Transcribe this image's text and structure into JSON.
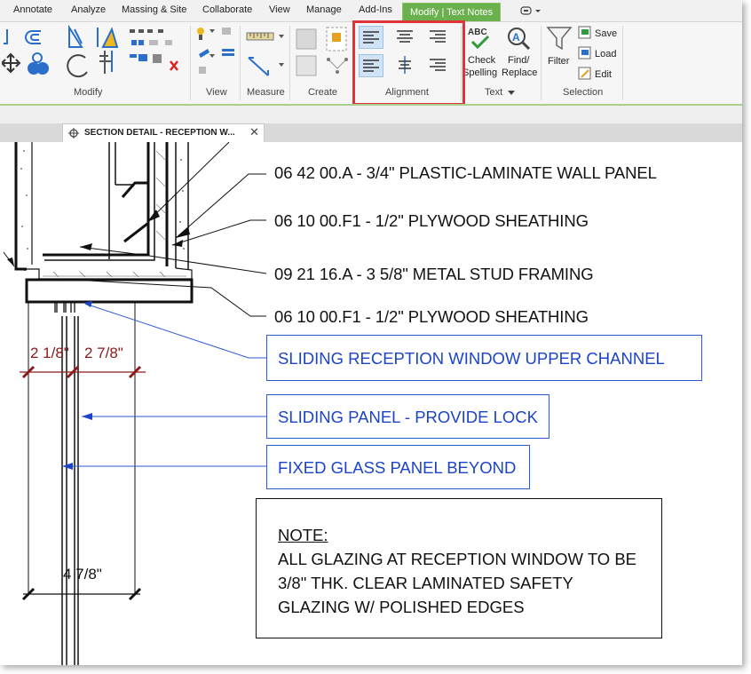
{
  "ribbon": {
    "tabs": [
      "Annotate",
      "Analyze",
      "Massing & Site",
      "Collaborate",
      "View",
      "Manage",
      "Add-Ins",
      "Modify | Text Notes"
    ],
    "active_tab": "Modify | Text Notes",
    "accent_color": "#6ab04c",
    "panels": {
      "modify": "Modify",
      "view": "View",
      "measure": "Measure",
      "create": "Create",
      "alignment": "Alignment",
      "text": "Text",
      "selection": "Selection"
    },
    "text_tools": {
      "check": "Check",
      "spelling": "Spelling",
      "find": "Find/",
      "replace": "Replace"
    },
    "selection_tools": {
      "filter": "Filter",
      "save": "Save",
      "load": "Load",
      "edit": "Edit"
    },
    "highlight_color": "#e0343a"
  },
  "view_tab": {
    "title": "SECTION DETAIL - RECEPTION W...",
    "close_icon": "close-icon"
  },
  "drawing": {
    "keynotes": [
      "06 42 00.A - 3/4\" PLASTIC-LAMINATE WALL PANEL",
      "06 10 00.F1 - 1/2\" PLYWOOD SHEATHING",
      "09 21 16.A - 3 5/8\" METAL STUD FRAMING",
      "06 10 00.F1 - 1/2\" PLYWOOD SHEATHING"
    ],
    "tags": [
      "SLIDING RECEPTION WINDOW UPPER CHANNEL",
      "SLIDING PANEL - PROVIDE LOCK",
      "FIXED GLASS PANEL BEYOND"
    ],
    "tag_color": "#1c44c9",
    "dimensions": {
      "left": "2 1/8\"",
      "right": "2 7/8\"",
      "total": "4 7/8\""
    },
    "dimension_color": "#8b1a1a",
    "note": {
      "heading": "NOTE:",
      "lines": [
        "ALL GLAZING AT RECEPTION WINDOW TO BE",
        "3/8\" THK. CLEAR LAMINATED SAFETY",
        "GLAZING W/ POLISHED EDGES"
      ]
    }
  }
}
